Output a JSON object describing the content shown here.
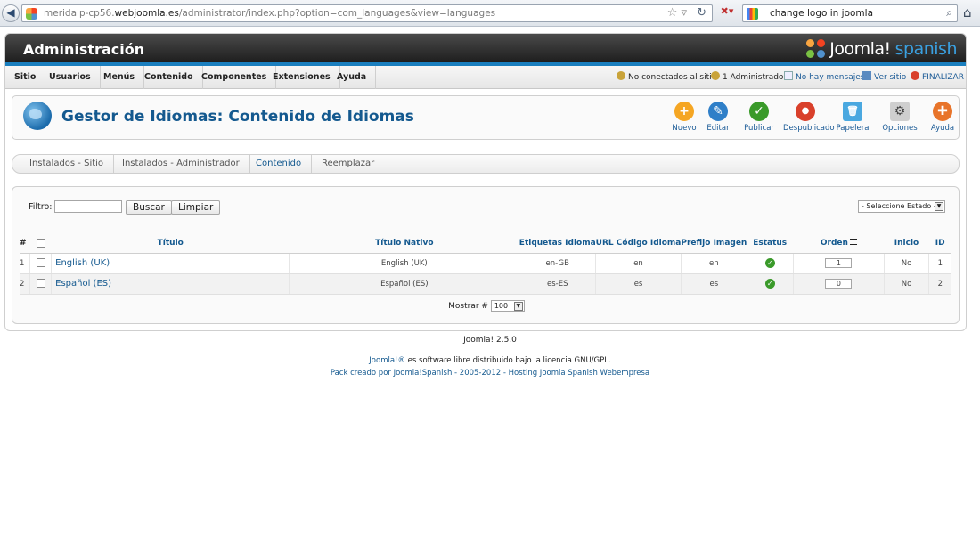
{
  "browser": {
    "url_prefix": "meridaip-cp56.",
    "url_domain": "webjoomla.es",
    "url_path": "/administrator/index.php?option=com_languages&view=languages",
    "search_query": "change logo in joomla"
  },
  "header": {
    "title": "Administración",
    "logo_text": "Joomla!",
    "logo_sub": "spanish"
  },
  "menu": {
    "items": [
      "Sitio",
      "Usuarios",
      "Menús",
      "Contenido",
      "Componentes",
      "Extensiones",
      "Ayuda"
    ],
    "status": {
      "visitors": "No conectados al sitio",
      "admins": "1 Administrador",
      "messages": "No hay mensajes",
      "view_site": "Ver sitio",
      "logout": "FINALIZAR"
    }
  },
  "toolbar": {
    "page_title": "Gestor de Idiomas: Contenido de Idiomas",
    "buttons": [
      {
        "label": "Nuevo",
        "color": "#f5a623",
        "glyph": "+"
      },
      {
        "label": "Editar",
        "color": "#2f7fc8",
        "glyph": "✎"
      },
      {
        "label": "Publicar",
        "color": "#3a9a2a",
        "glyph": "✓"
      },
      {
        "label": "Despublicado",
        "color": "#d9402b",
        "glyph": "●"
      },
      {
        "label": "Papelera",
        "color": "#4aa8e0",
        "glyph": "🗑"
      },
      {
        "label": "Opciones",
        "color": "#999999",
        "glyph": "⚙"
      },
      {
        "label": "Ayuda",
        "color": "#e8742a",
        "glyph": "✚"
      }
    ]
  },
  "subtabs": [
    "Instalados - Sitio",
    "Instalados - Administrador",
    "Contenido",
    "Reemplazar"
  ],
  "filters": {
    "filter_label": "Filtro:",
    "filter_value": "",
    "search_button": "Buscar",
    "clear_button": "Limpiar",
    "status_select": "- Seleccione Estado -"
  },
  "table": {
    "headers": [
      "#",
      "",
      "Título",
      "Título Nativo",
      "Etiquetas Idioma",
      "URL Código Idioma",
      "Prefijo Imagen",
      "Estatus",
      "Orden",
      "Inicio",
      "ID"
    ],
    "rows": [
      {
        "num": "1",
        "title": "English (UK)",
        "native": "English (UK)",
        "tag": "en-GB",
        "url_code": "en",
        "prefix": "en",
        "order": "1",
        "home": "No",
        "id": "1"
      },
      {
        "num": "2",
        "title": "Español (ES)",
        "native": "Español (ES)",
        "tag": "es-ES",
        "url_code": "es",
        "prefix": "es",
        "order": "0",
        "home": "No",
        "id": "2"
      }
    ]
  },
  "pager": {
    "label": "Mostrar #",
    "value": "100"
  },
  "footer": {
    "version": "Joomla! 2.5.0",
    "license_link": "Joomla!®",
    "license_text": " es software libre distribuido bajo la licencia GNU/GPL.",
    "credits": "Pack creado por Joomla!Spanish - 2005-2012 - Hosting Joomla Spanish Webempresa"
  }
}
